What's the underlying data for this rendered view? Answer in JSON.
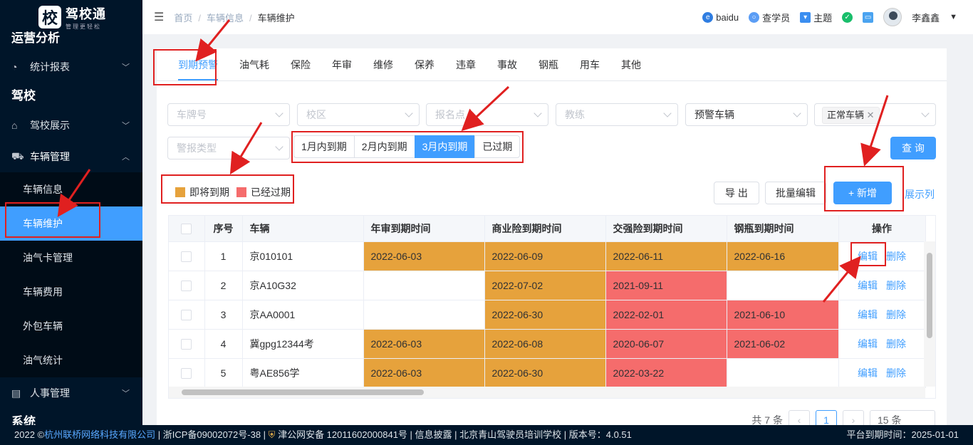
{
  "sidebar": {
    "logo_mark": "校",
    "logo_title": "驾校通",
    "logo_sub": "管理更轻松",
    "group1": "运营分析",
    "item_stats": "统计报表",
    "group2": "驾校",
    "item_school": "驾校展示",
    "item_vehicle": "车辆管理",
    "sub_items": [
      "车辆信息",
      "车辆维护",
      "油气卡管理",
      "车辆费用",
      "外包车辆",
      "油气统计"
    ],
    "item_hr": "人事管理",
    "group3": "系统"
  },
  "header": {
    "breadcrumb": [
      "首页",
      "车辆信息",
      "车辆维护"
    ],
    "baidu": "baidu",
    "check_student": "查学员",
    "theme": "主题",
    "user": "李鑫鑫"
  },
  "tabs": [
    "到期预警",
    "油气耗",
    "保险",
    "年审",
    "维修",
    "保养",
    "违章",
    "事故",
    "钢瓶",
    "用车",
    "其他"
  ],
  "filters": {
    "plate": "车牌号",
    "campus": "校区",
    "signup": "报名点",
    "coach": "教练",
    "warn_vehicle": "预警车辆",
    "normal_tag": "正常车辆",
    "alarm_type": "警报类型",
    "periods": [
      "1月内到期",
      "2月内到期",
      "3月内到期",
      "已过期"
    ]
  },
  "buttons": {
    "query": "查 询",
    "export": "导 出",
    "batch_edit": "批量编辑",
    "add": "+ 新增",
    "show_cols": "展示列"
  },
  "legend": {
    "soon": "即将到期",
    "expired": "已经过期"
  },
  "colors": {
    "soon": "#e6a23c",
    "expired": "#f56c6c",
    "primary": "#409eff"
  },
  "table": {
    "headers": [
      "序号",
      "车辆",
      "年审到期时间",
      "商业险到期时间",
      "交强险到期时间",
      "钢瓶到期时间",
      "操作"
    ],
    "edit": "编辑",
    "delete": "删除",
    "rows": [
      {
        "no": "1",
        "car": "京010101",
        "annual": "2022-06-03",
        "comm": "2022-06-09",
        "comp": "2022-06-11",
        "cyl": "2022-06-16"
      },
      {
        "no": "2",
        "car": "京A10G32",
        "annual": "",
        "comm": "2022-07-02",
        "comp": "2021-09-11",
        "cyl": ""
      },
      {
        "no": "3",
        "car": "京AA0001",
        "annual": "",
        "comm": "2022-06-30",
        "comp": "2022-02-01",
        "cyl": "2021-06-10"
      },
      {
        "no": "4",
        "car": "冀gpg12344考",
        "annual": "2022-06-03",
        "comm": "2022-06-08",
        "comp": "2020-06-07",
        "cyl": "2021-06-02"
      },
      {
        "no": "5",
        "car": "粤AE856学",
        "annual": "2022-06-03",
        "comm": "2022-06-30",
        "comp": "2022-03-22",
        "cyl": ""
      }
    ]
  },
  "pager": {
    "total": "共 7 条",
    "page": "1",
    "size": "15 条"
  },
  "footer": {
    "copy": "2022 ©",
    "company": "杭州联桥网络科技有限公司",
    "icp": "| 浙ICP备09002072号-38 |",
    "police": "津公网安备 12011602000841号 | 信息披露 | 北京青山驾驶员培训学校 | 版本号：4.0.51",
    "expire": "平台到期时间：2025-01-01"
  }
}
